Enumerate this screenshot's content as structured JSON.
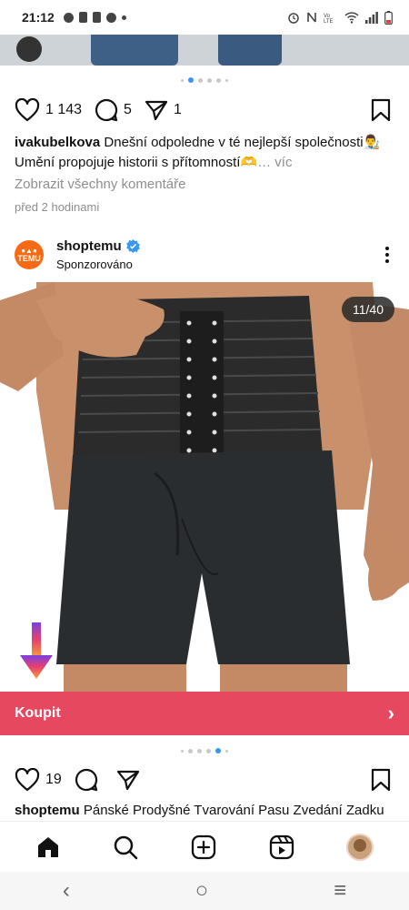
{
  "status_bar": {
    "time": "21:12"
  },
  "previous_post": {
    "pager_dots": 6,
    "active_dot": 1,
    "likes": "1 143",
    "comments": "5",
    "shares": "1",
    "username": "ivakubelkova",
    "caption_line1": "Dnešní odpoledne v té nejlepší společnosti👨‍🎨",
    "caption_line2": "Umění propojuje historii s přítomností🫶",
    "more_label": "… víc",
    "view_comments": "Zobrazit všechny komentáře",
    "time_ago": "před 2 hodinami"
  },
  "sponsored_post": {
    "username": "shoptemu",
    "subtitle": "Sponzorováno",
    "avatar_text": "TEMU",
    "image_counter": "11/40",
    "buy_label": "Koupit",
    "buy_chevron": "›",
    "pager_dots": 6,
    "active_dot": 4,
    "likes": "19",
    "caption_username": "shoptemu",
    "caption_text": "Pánské Prodyšné Tvarování Pasu Zvedání Zadku"
  },
  "bottom_nav": {
    "items": [
      "home-icon",
      "search-icon",
      "create-icon",
      "reels-icon",
      "profile-avatar"
    ]
  },
  "system_nav": {
    "back": "‹",
    "home": "○",
    "recents": "≡"
  },
  "colors": {
    "accent_blue": "#3897f0",
    "buy_bar": "#e6485f",
    "temu_orange": "#f56a12"
  }
}
